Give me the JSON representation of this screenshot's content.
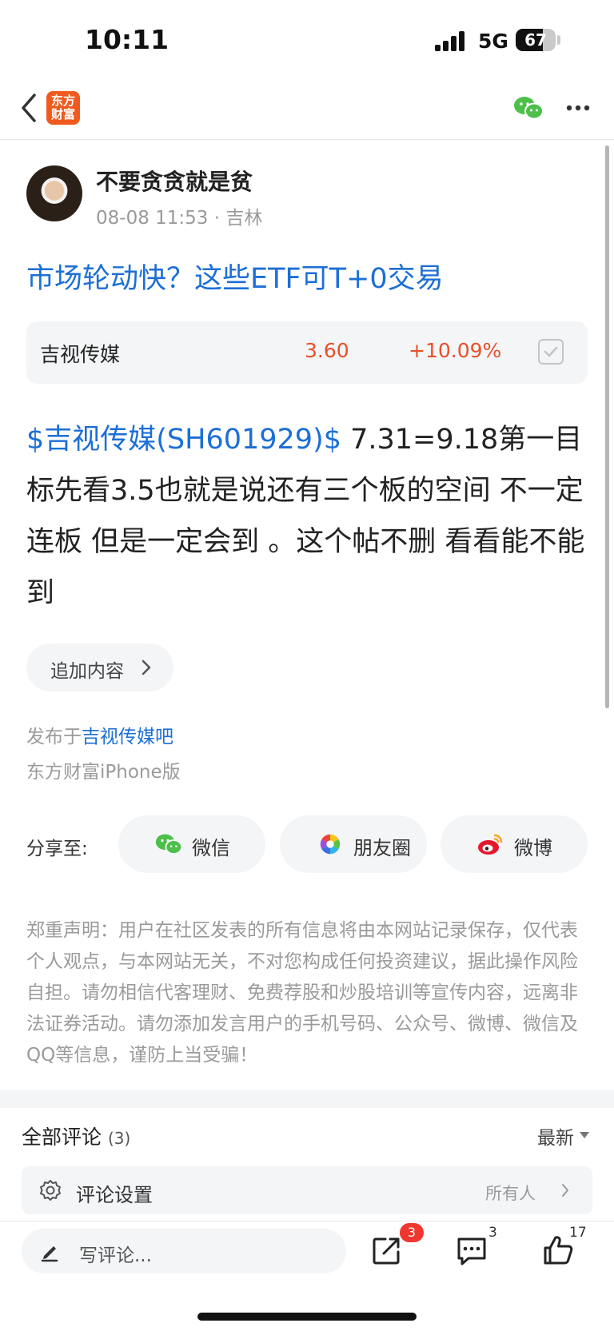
{
  "status_bar": {
    "time": "10:11",
    "network": "5G",
    "battery": "67"
  },
  "nav": {
    "logo_text": "东方财富"
  },
  "post": {
    "author": "不要贪贪就是贫",
    "datetime": "08-08 11:53",
    "location": "吉林",
    "title": "市场轮动快？这些ETF可T+0交易",
    "stock_card": {
      "name": "吉视传媒",
      "price": "3.60",
      "change": "+10.09%"
    },
    "stock_link": "$吉视传媒(SH601929)$",
    "body": " 7.31=9.18第一目标先看3.5也就是说还有三个板的空间 不一定连板 但是一定会到 。这个帖不删 看看能不能到",
    "append_label": "追加内容",
    "published_prefix": "发布于",
    "published_forum": "吉视传媒吧",
    "client": "东方财富iPhone版"
  },
  "share": {
    "label": "分享至:",
    "targets": [
      {
        "label": "微信",
        "icon": "wechat-icon"
      },
      {
        "label": "朋友圈",
        "icon": "moments-icon"
      },
      {
        "label": "微博",
        "icon": "weibo-icon"
      }
    ]
  },
  "disclaimer": "郑重声明：用户在社区发表的所有信息将由本网站记录保存，仅代表个人观点，与本网站无关，不对您构成任何投资建议，据此操作风险自担。请勿相信代客理财、免费荐股和炒股培训等宣传内容，远离非法证券活动。请勿添加发言用户的手机号码、公众号、微博、微信及QQ等信息，谨防上当受骗！",
  "comments": {
    "title": "全部评论",
    "count": "(3)",
    "sort": "最新",
    "setting_label": "评论设置",
    "setting_value": "所有人"
  },
  "bottom_bar": {
    "write_placeholder": "写评论...",
    "share_badge": "3",
    "comment_count": "3",
    "like_count": "17"
  },
  "colors": {
    "accent_blue": "#1c6fd6",
    "up_red": "#e8502a",
    "badge_red": "#f0362e",
    "brand_orange": "#f15a1e"
  }
}
